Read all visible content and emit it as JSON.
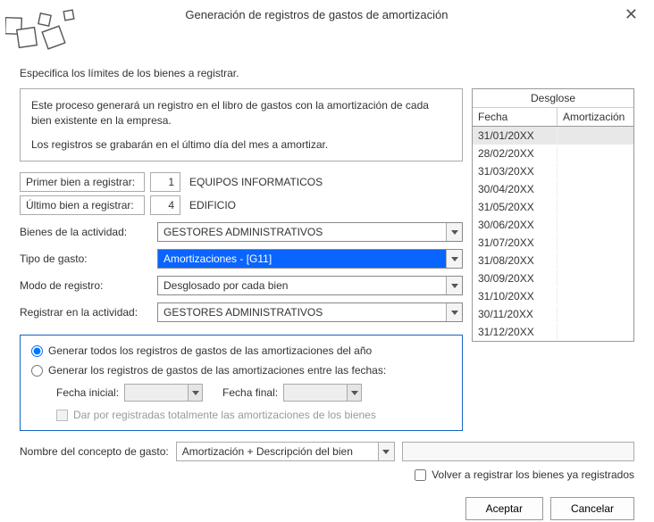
{
  "title": "Generación de registros de gastos de amortización",
  "subtitle": "Especifica los límites de los bienes a registrar.",
  "explain_p1": "Este proceso generará un registro en el libro de gastos con la amortización de cada bien existente en la empresa.",
  "explain_p2": "Los registros se grabarán en el último día del mes a amortizar.",
  "primer_bien": {
    "label": "Primer bien a registrar:",
    "num": "1",
    "name": "EQUIPOS INFORMATICOS"
  },
  "ultimo_bien": {
    "label": "Último bien a registrar:",
    "num": "4",
    "name": "EDIFICIO"
  },
  "actividad": {
    "label": "Bienes de la actividad:",
    "value": "GESTORES ADMINISTRATIVOS"
  },
  "tipo_gasto": {
    "label": "Tipo de gasto:",
    "value": "Amortizaciones - [G11]"
  },
  "modo_registro": {
    "label": "Modo de registro:",
    "value": "Desglosado por cada bien"
  },
  "registrar_actividad": {
    "label": "Registrar en la actividad:",
    "value": "GESTORES ADMINISTRATIVOS"
  },
  "radio1": "Generar todos los registros de gastos de las amortizaciones del año",
  "radio2": "Generar los registros de gastos de las amortizaciones entre las fechas:",
  "fecha_inicial_label": "Fecha inicial:",
  "fecha_final_label": "Fecha final:",
  "chk_dar": "Dar por registradas totalmente las amortizaciones de los bienes",
  "concepto_label": "Nombre del concepto de gasto:",
  "concepto_value": "Amortización + Descripción del bien",
  "re_registrar": "Volver a registrar los bienes ya registrados",
  "btn_aceptar": "Aceptar",
  "btn_cancelar": "Cancelar",
  "desglose": {
    "title": "Desglose",
    "col1": "Fecha",
    "col2": "Amortización",
    "rows": [
      {
        "fecha": "31/01/20XX",
        "amort": ""
      },
      {
        "fecha": "28/02/20XX",
        "amort": ""
      },
      {
        "fecha": "31/03/20XX",
        "amort": ""
      },
      {
        "fecha": "30/04/20XX",
        "amort": ""
      },
      {
        "fecha": "31/05/20XX",
        "amort": ""
      },
      {
        "fecha": "30/06/20XX",
        "amort": ""
      },
      {
        "fecha": "31/07/20XX",
        "amort": ""
      },
      {
        "fecha": "31/08/20XX",
        "amort": ""
      },
      {
        "fecha": "30/09/20XX",
        "amort": ""
      },
      {
        "fecha": "31/10/20XX",
        "amort": ""
      },
      {
        "fecha": "30/11/20XX",
        "amort": ""
      },
      {
        "fecha": "31/12/20XX",
        "amort": ""
      }
    ]
  }
}
